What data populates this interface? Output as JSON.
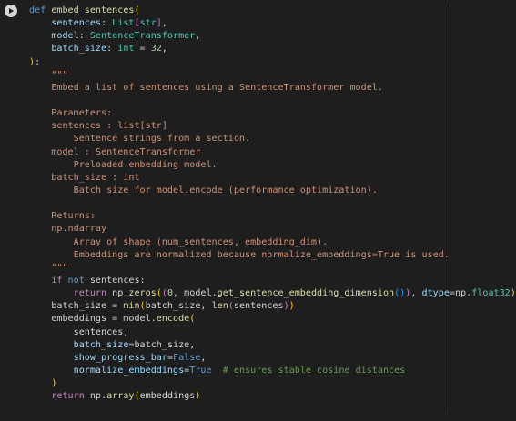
{
  "cell": {
    "language": "python",
    "run_icon": "play-circle-icon"
  },
  "colors": {
    "background": "#1e1e1e",
    "keyword": "#569cd6",
    "control_keyword": "#c586c0",
    "function": "#dcdcaa",
    "parameter": "#9cdcfe",
    "type": "#4ec9b0",
    "number": "#b5cea8",
    "string": "#ce9178",
    "comment": "#6a9955",
    "text": "#d4d4d4"
  },
  "lines": [
    [
      [
        "kw",
        "def"
      ],
      [
        "txt",
        " "
      ],
      [
        "fn",
        "embed_sentences"
      ],
      [
        "p1",
        "("
      ]
    ],
    [
      [
        "txt",
        "    "
      ],
      [
        "param",
        "sentences"
      ],
      [
        "txt",
        ": "
      ],
      [
        "type",
        "List"
      ],
      [
        "p2",
        "["
      ],
      [
        "type",
        "str"
      ],
      [
        "p2",
        "]"
      ],
      [
        "txt",
        ","
      ]
    ],
    [
      [
        "txt",
        "    "
      ],
      [
        "param",
        "model"
      ],
      [
        "txt",
        ": "
      ],
      [
        "type",
        "SentenceTransformer"
      ],
      [
        "txt",
        ","
      ]
    ],
    [
      [
        "txt",
        "    "
      ],
      [
        "param",
        "batch_size"
      ],
      [
        "txt",
        ": "
      ],
      [
        "type",
        "int"
      ],
      [
        "txt",
        " = "
      ],
      [
        "num",
        "32"
      ],
      [
        "txt",
        ","
      ]
    ],
    [
      [
        "p1",
        ")"
      ],
      [
        "txt",
        ":"
      ]
    ],
    [
      [
        "str",
        "    \"\"\""
      ]
    ],
    [
      [
        "str",
        "    Embed a list of sentences using a SentenceTransformer model."
      ]
    ],
    [
      [
        "str",
        ""
      ]
    ],
    [
      [
        "str",
        "    Parameters:"
      ]
    ],
    [
      [
        "str",
        "    sentences : list[str]"
      ]
    ],
    [
      [
        "str",
        "        Sentence strings from a section."
      ]
    ],
    [
      [
        "str",
        "    model : SentenceTransformer"
      ]
    ],
    [
      [
        "str",
        "        Preloaded embedding model."
      ]
    ],
    [
      [
        "str",
        "    batch_size : int"
      ]
    ],
    [
      [
        "str",
        "        Batch size for model.encode (performance optimization)."
      ]
    ],
    [
      [
        "str",
        ""
      ]
    ],
    [
      [
        "str",
        "    Returns:"
      ]
    ],
    [
      [
        "str",
        "    np.ndarray"
      ]
    ],
    [
      [
        "str",
        "        Array of shape (num_sentences, embedding_dim)."
      ]
    ],
    [
      [
        "str",
        "        Embeddings are normalized because normalize_embeddings=True is used."
      ]
    ],
    [
      [
        "str",
        "    \"\"\""
      ]
    ],
    [
      [
        "txt",
        "    "
      ],
      [
        "kw-ctrl",
        "if"
      ],
      [
        "txt",
        " "
      ],
      [
        "kw",
        "not"
      ],
      [
        "txt",
        " sentences:"
      ]
    ],
    [
      [
        "txt",
        "        "
      ],
      [
        "kw-ctrl",
        "return"
      ],
      [
        "txt",
        " np."
      ],
      [
        "fn",
        "zeros"
      ],
      [
        "p1",
        "("
      ],
      [
        "p2",
        "("
      ],
      [
        "num",
        "0"
      ],
      [
        "txt",
        ", model."
      ],
      [
        "fn",
        "get_sentence_embedding_dimension"
      ],
      [
        "p3",
        "("
      ],
      [
        "p3",
        ")"
      ],
      [
        "p2",
        ")"
      ],
      [
        "txt",
        ", "
      ],
      [
        "param",
        "dtype"
      ],
      [
        "txt",
        "=np."
      ],
      [
        "type",
        "float32"
      ],
      [
        "p1",
        ")"
      ]
    ],
    [
      [
        "txt",
        "    batch_size = "
      ],
      [
        "fn",
        "min"
      ],
      [
        "p1",
        "("
      ],
      [
        "txt",
        "batch_size, "
      ],
      [
        "fn",
        "len"
      ],
      [
        "p2",
        "("
      ],
      [
        "txt",
        "sentences"
      ],
      [
        "p2",
        ")"
      ],
      [
        "p1",
        ")"
      ]
    ],
    [
      [
        "txt",
        "    embeddings = model."
      ],
      [
        "fn",
        "encode"
      ],
      [
        "p1",
        "("
      ]
    ],
    [
      [
        "txt",
        "        sentences,"
      ]
    ],
    [
      [
        "txt",
        "        "
      ],
      [
        "param",
        "batch_size"
      ],
      [
        "txt",
        "=batch_size,"
      ]
    ],
    [
      [
        "txt",
        "        "
      ],
      [
        "param",
        "show_progress_bar"
      ],
      [
        "txt",
        "="
      ],
      [
        "kw",
        "False"
      ],
      [
        "txt",
        ","
      ]
    ],
    [
      [
        "txt",
        "        "
      ],
      [
        "param",
        "normalize_embeddings"
      ],
      [
        "txt",
        "="
      ],
      [
        "kw",
        "True"
      ],
      [
        "txt",
        "  "
      ],
      [
        "cmt",
        "# ensures stable cosine distances"
      ]
    ],
    [
      [
        "txt",
        "    "
      ],
      [
        "p1",
        ")"
      ]
    ],
    [
      [
        "txt",
        "    "
      ],
      [
        "kw-ctrl",
        "return"
      ],
      [
        "txt",
        " np."
      ],
      [
        "fn",
        "array"
      ],
      [
        "p1",
        "("
      ],
      [
        "txt",
        "embeddings"
      ],
      [
        "p1",
        ")"
      ]
    ]
  ]
}
